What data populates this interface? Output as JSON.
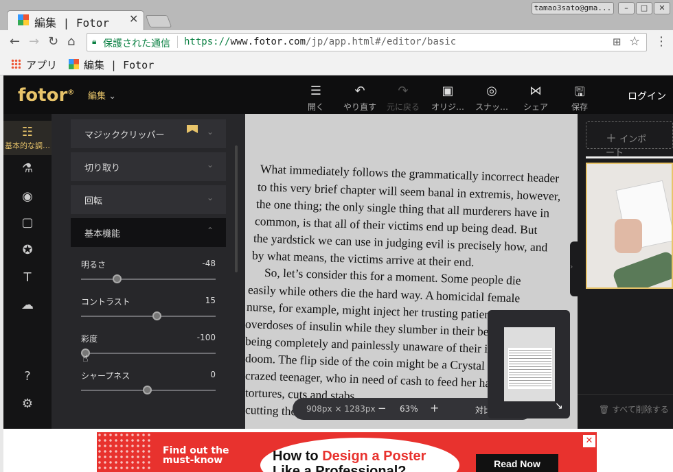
{
  "browser": {
    "tab_title": "編集 | Fotor",
    "user": "tamao3sato@gma...",
    "secure_label": "保護された通信",
    "url_scheme": "https://",
    "url_host": "www.fotor.com",
    "url_path": "/jp/app.html#/editor/basic",
    "bookmarks": [
      {
        "label": "アプリ"
      },
      {
        "label": "編集 | Fotor"
      }
    ]
  },
  "app": {
    "logo": "fotor",
    "edit_menu": "編集",
    "login": "ログイン",
    "tools": [
      {
        "label": "開く",
        "icon": "menu-icon"
      },
      {
        "label": "やり直す",
        "icon": "undo-icon"
      },
      {
        "label": "元に戻る",
        "icon": "redo-icon",
        "disabled": true
      },
      {
        "label": "オリジ…",
        "icon": "image-icon"
      },
      {
        "label": "スナッ…",
        "icon": "snapshot-icon"
      },
      {
        "label": "シェア",
        "icon": "share-icon"
      },
      {
        "label": "保存",
        "icon": "save-icon"
      }
    ],
    "nav_selected_label": "基本的な調…",
    "accordion": [
      {
        "label": "マジッククリッパー"
      },
      {
        "label": "切り取り"
      },
      {
        "label": "回転"
      },
      {
        "label": "基本機能"
      }
    ],
    "sliders": [
      {
        "label": "明るさ",
        "value": "-48",
        "fraction": 0.26
      },
      {
        "label": "コントラスト",
        "value": "15",
        "fraction": 0.575
      },
      {
        "label": "彩度",
        "value": "-100",
        "fraction": 0.0
      },
      {
        "label": "シャープネス",
        "value": "0",
        "fraction": 0.5
      }
    ],
    "zoom": {
      "size": "908px × 1283px",
      "percent": "63%",
      "compare": "対比"
    },
    "import_label": "インポート",
    "delete_all": "すべて削除する",
    "page_text": [
      "What immediately follows the grammatically incorrect header",
      "to this very brief chapter will seem banal in extremis, however,",
      "the one thing; the only single thing that all murderers have in",
      "common, is that all of their victims end up being dead. But",
      "the yardstick we can use in judging evil is precisely how, and",
      "by what means, the victims arrive at their end.",
      "So, let’s consider this for a moment. Some people die",
      "easily while others die the hard way. A homicidal female",
      "nurse, for example, might inject her trusting patients with",
      "overdoses of insulin while they slumber in their beds thus",
      "being completely and painlessly unaware of their impending",
      "doom. The flip side of the coin might be a Crystal Meth",
      "crazed teenager, who in need of cash to feed her habit,",
      "tortures, cuts and stabs",
      "cutting their"
    ]
  },
  "ad": {
    "left_text": "Find out the must-know",
    "headline_a": "How to ",
    "headline_b": "Design a Poster",
    "headline_c": "Like a Professional?",
    "cta": "Read Now"
  }
}
